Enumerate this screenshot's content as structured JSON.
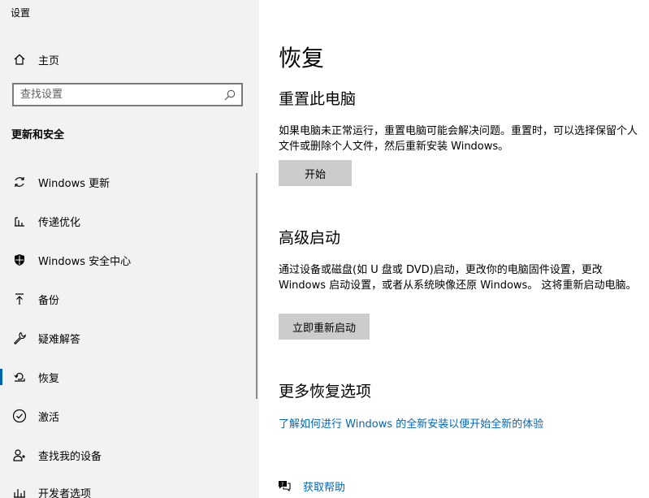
{
  "window": {
    "title": "设置"
  },
  "sidebar": {
    "home_label": "主页",
    "search_placeholder": "查找设置",
    "section_header": "更新和安全",
    "items": [
      {
        "label": "Windows 更新",
        "icon": "sync-icon"
      },
      {
        "label": "传递优化",
        "icon": "delivery-optimization-icon"
      },
      {
        "label": "Windows 安全中心",
        "icon": "shield-icon"
      },
      {
        "label": "备份",
        "icon": "backup-upload-icon"
      },
      {
        "label": "疑难解答",
        "icon": "wrench-icon"
      },
      {
        "label": "恢复",
        "icon": "recovery-icon",
        "active": true
      },
      {
        "label": "激活",
        "icon": "checkmark-circle-icon"
      },
      {
        "label": "查找我的设备",
        "icon": "person-location-icon"
      },
      {
        "label": "开发者选项",
        "icon": "developer-icon"
      }
    ]
  },
  "main": {
    "title": "恢复",
    "reset": {
      "heading": "重置此电脑",
      "description": "如果电脑未正常运行，重置电脑可能会解决问题。重置时，可以选择保留个人文件或删除个人文件，然后重新安装 Windows。",
      "button": "开始"
    },
    "advanced": {
      "heading": "高级启动",
      "description": "通过设备或磁盘(如 U 盘或 DVD)启动，更改你的电脑固件设置，更改 Windows 启动设置，或者从系统映像还原 Windows。 这将重新启动电脑。",
      "button": "立即重新启动"
    },
    "more": {
      "heading": "更多恢复选项",
      "link": "了解如何进行 Windows 的全新安装以便开始全新的体验"
    },
    "help": {
      "label": "获取帮助"
    }
  },
  "colors": {
    "accent": "#0063b1",
    "link": "#0067b8",
    "sidebar_bg": "#f2f2f2",
    "button_bg": "#cccccc"
  }
}
